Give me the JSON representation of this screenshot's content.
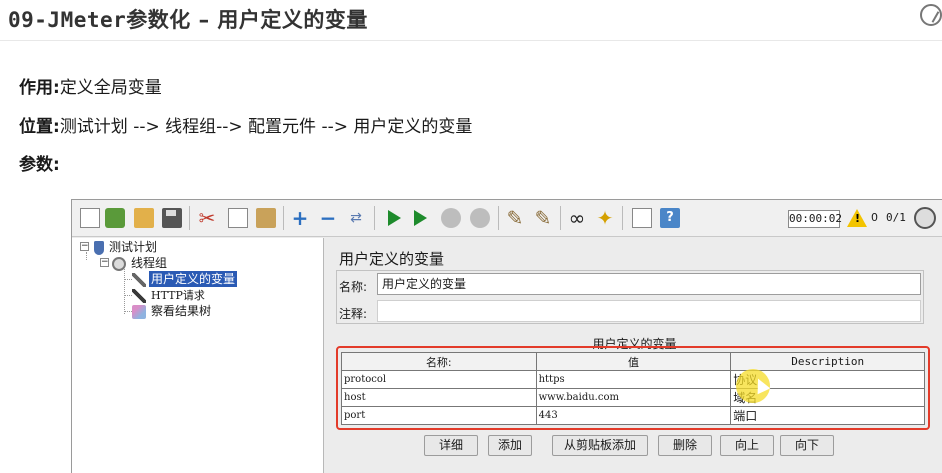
{
  "slide": {
    "title_prefix": "09-JMeter",
    "title_rest": "参数化 – 用户定义的变量",
    "lines": [
      {
        "key": "作用:",
        "value": "定义全局变量"
      },
      {
        "key": "位置:",
        "value": "测试计划 --> 线程组--> 配置元件 --> 用户定义的变量"
      },
      {
        "key": "参数:",
        "value": ""
      }
    ]
  },
  "toolbar": {
    "timer": "00:00:02",
    "warning_count": "0",
    "thread_count": "0/1",
    "icons": [
      "new-icon",
      "templates-icon",
      "open-icon",
      "save-icon",
      "cut-icon",
      "copy-icon",
      "paste-icon",
      "expand-icon",
      "collapse-icon",
      "toggle-icon",
      "start-icon",
      "start-no-pause-icon",
      "stop-icon",
      "shutdown-icon",
      "clear-icon",
      "clear-all-icon",
      "search-icon",
      "reset-search-icon",
      "function-helper-icon",
      "help-icon"
    ]
  },
  "tree": {
    "items": [
      {
        "label": "测试计划"
      },
      {
        "label": "线程组"
      },
      {
        "label": "用户定义的变量"
      },
      {
        "label": "HTTP请求"
      },
      {
        "label": "察看结果树"
      }
    ]
  },
  "panel": {
    "title": "用户定义的变量",
    "name_label": "名称:",
    "name_value": "用户定义的变量",
    "comment_label": "注释:",
    "comment_value": "",
    "table_caption": "用户定义的变量",
    "columns": [
      "名称:",
      "值",
      "Description"
    ],
    "rows": [
      {
        "name": "protocol",
        "value": "https",
        "desc": "协议"
      },
      {
        "name": "host",
        "value": "www.baidu.com",
        "desc": "域名"
      },
      {
        "name": "port",
        "value": "443",
        "desc": "端口"
      }
    ],
    "buttons": [
      "详细",
      "添加",
      "从剪贴板添加",
      "删除",
      "向上",
      "向下"
    ]
  },
  "colors": {
    "selection": "#2a5ab4",
    "highlight_border": "#e33b2a",
    "cursor_highlight": "#f5dc28"
  }
}
